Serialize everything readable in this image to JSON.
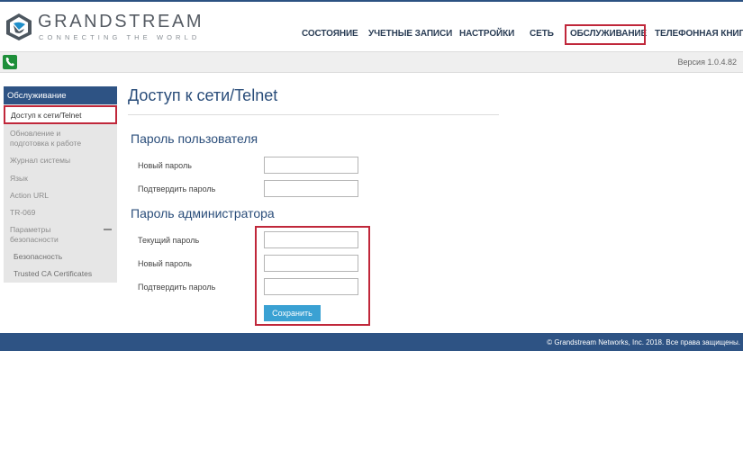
{
  "brand": {
    "name": "GRANDSTREAM",
    "tagline": "CONNECTING THE WORLD",
    "colors": {
      "primary": "#2e5384",
      "accent": "#c0273a",
      "button": "#3aa1d3"
    }
  },
  "nav": {
    "items": [
      {
        "label": "СОСТОЯНИЕ"
      },
      {
        "label": "УЧЕТНЫЕ ЗАПИСИ"
      },
      {
        "label": "НАСТРОЙКИ"
      },
      {
        "label": "СЕТЬ"
      },
      {
        "label": "ОБСЛУЖИВАНИЕ"
      },
      {
        "label": "ТЕЛЕФОННАЯ КНИГА"
      }
    ],
    "active": "ОБСЛУЖИВАНИЕ"
  },
  "toolbar": {
    "phone_icon": "phone-icon",
    "version": "Версия 1.0.4.82"
  },
  "sidebar": {
    "header": "Обслуживание",
    "active_item": "Доступ к сети/Telnet",
    "items": [
      {
        "label": "Обновление и подготовка к работе"
      },
      {
        "label": "Журнал системы"
      },
      {
        "label": "Язык"
      },
      {
        "label": "Action URL"
      },
      {
        "label": "TR-069"
      },
      {
        "label": "Параметры безопасности"
      }
    ],
    "sub_items": [
      {
        "label": "Безопасность"
      },
      {
        "label": "Trusted CA Certificates"
      }
    ]
  },
  "main": {
    "title": "Доступ к сети/Telnet",
    "user_section": {
      "title": "Пароль пользователя",
      "new_password_label": "Новый пароль",
      "confirm_password_label": "Подтвердить пароль"
    },
    "admin_section": {
      "title": "Пароль администратора",
      "current_password_label": "Текущий пароль",
      "new_password_label": "Новый пароль",
      "confirm_password_label": "Подтвердить пароль"
    },
    "save_label": "Сохранить"
  },
  "footer": {
    "copyright": "© Grandstream Networks, Inc. 2018. Все права защищены."
  }
}
